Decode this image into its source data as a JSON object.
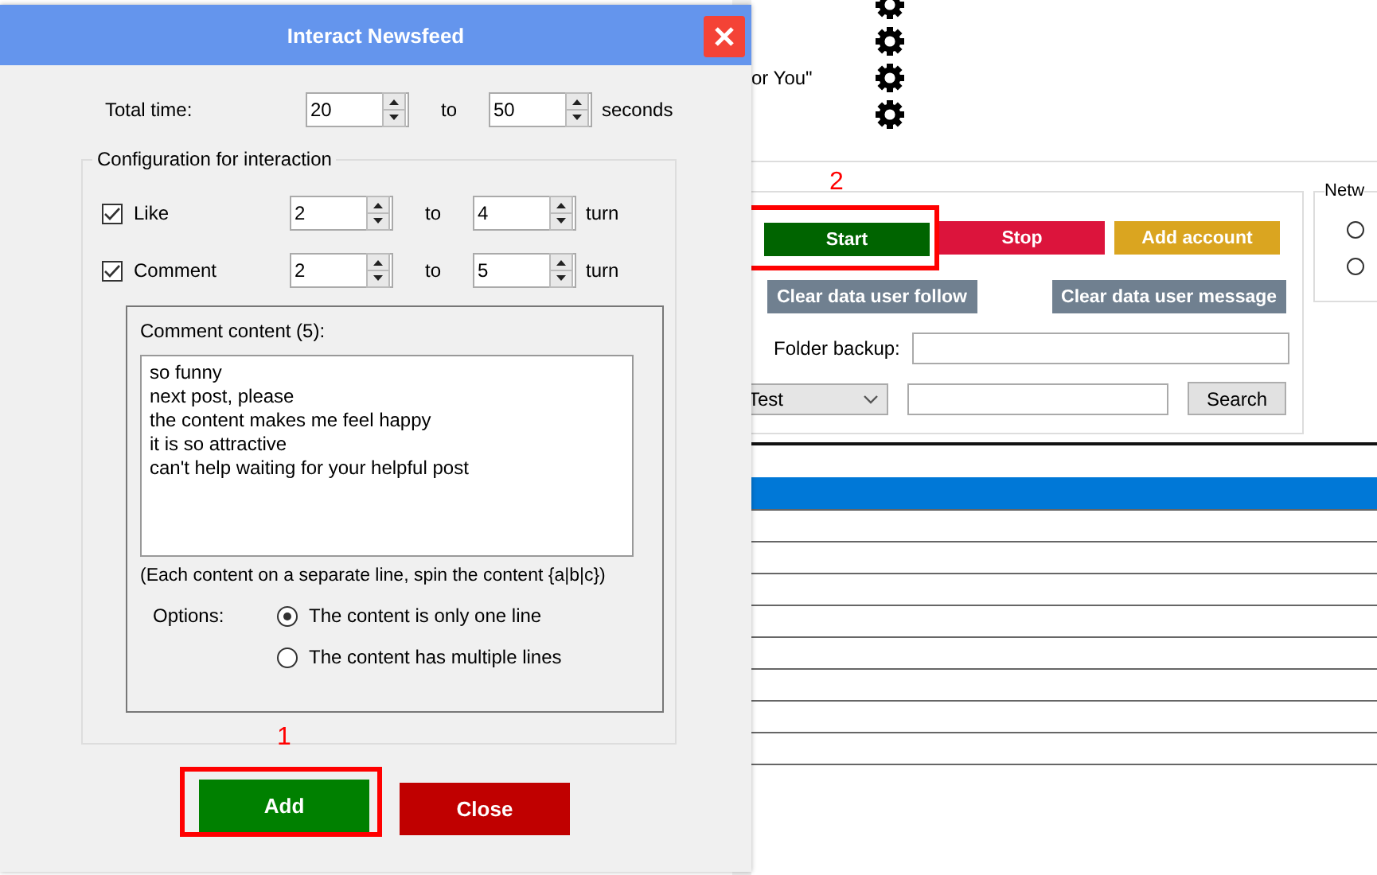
{
  "background": {
    "caption": "or You\"",
    "action_buttons": [
      {
        "label": "Start",
        "color": "#006400",
        "callout": "2"
      },
      {
        "label": "Stop",
        "color": "#dc143c"
      },
      {
        "label": "Add account",
        "color": "#daa520"
      }
    ],
    "clear_buttons": [
      {
        "label": "Clear data user follow"
      },
      {
        "label": "Clear data user message"
      }
    ],
    "folder_label": "Folder backup:",
    "combo_value": "Test",
    "search_button": "Search",
    "network_label": "Netw",
    "network_options": [
      {
        "selected": false
      },
      {
        "selected": false
      }
    ]
  },
  "dialog": {
    "title": "Interact Newsfeed",
    "total_time": {
      "label": "Total time:",
      "from": "20",
      "to_label": "to",
      "to": "50",
      "unit": "seconds"
    },
    "config": {
      "title": "Configuration for interaction",
      "rows": [
        {
          "label": "Like",
          "checked": true,
          "from": "2",
          "to_label": "to",
          "to": "4",
          "unit": "turn"
        },
        {
          "label": "Comment",
          "checked": true,
          "from": "2",
          "to_label": "to",
          "to": "5",
          "unit": "turn"
        }
      ]
    },
    "comment_content": {
      "title": "Comment content (5):",
      "lines": [
        "so funny",
        "next post, please",
        "the content makes me feel happy",
        "it is so attractive",
        "can't help waiting for your helpful post"
      ],
      "hint": "(Each content on a separate line, spin the content {a|b|c})",
      "options_label": "Options:",
      "options": [
        {
          "label": "The content is only one line",
          "selected": true
        },
        {
          "label": "The content has multiple lines",
          "selected": false
        }
      ]
    },
    "buttons": [
      {
        "label": "Add",
        "kind": "confirm",
        "callout": "1"
      },
      {
        "label": "Close",
        "kind": "cancel"
      }
    ]
  }
}
